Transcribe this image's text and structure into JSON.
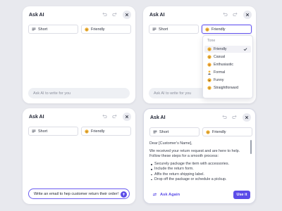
{
  "panels": [
    {
      "title": "Ask AI",
      "length_chip": "Short",
      "tone_chip": "Friendly",
      "prompt_placeholder": "Ask AI to write for you"
    },
    {
      "title": "Ask AI",
      "length_chip": "Short",
      "tone_chip": "Friendly",
      "prompt_placeholder": "Ask AI to write for you",
      "dropdown": {
        "header": "Tone",
        "items": [
          {
            "label": "Friendly",
            "icon": "smile-emoji-icon",
            "selected": true
          },
          {
            "label": "Casual",
            "icon": "grin-emoji-icon",
            "selected": false
          },
          {
            "label": "Enthusiastic",
            "icon": "star-eyes-emoji-icon",
            "selected": false
          },
          {
            "label": "Formal",
            "icon": "businessperson-emoji-icon",
            "selected": false
          },
          {
            "label": "Funny",
            "icon": "laughing-emoji-icon",
            "selected": false
          },
          {
            "label": "Straightforward",
            "icon": "neutral-emoji-icon",
            "selected": false
          }
        ]
      }
    },
    {
      "title": "Ask AI",
      "length_chip": "Short",
      "tone_chip": "Friendly",
      "prompt_value": "Write an email to hep customer return their order!"
    },
    {
      "title": "Ask AI",
      "length_chip": "Short",
      "tone_chip": "Friendly",
      "response": {
        "greeting": "Dear [Customer's Name],",
        "intro": "We received your return request and are here to help. Follow these steps for a smooth process:",
        "steps": [
          "Securely package the item with accessories.",
          "Include the return form.",
          "Affix the return shipping label.",
          "Drop off the package or schedule a pickup."
        ]
      },
      "ask_again_label": "Ask Again",
      "use_it_label": "Use it"
    }
  ],
  "colors": {
    "accent": "#5b4ce8",
    "background": "#e8e9ee",
    "panel": "#ffffff",
    "emoji": "#f4b63c"
  }
}
